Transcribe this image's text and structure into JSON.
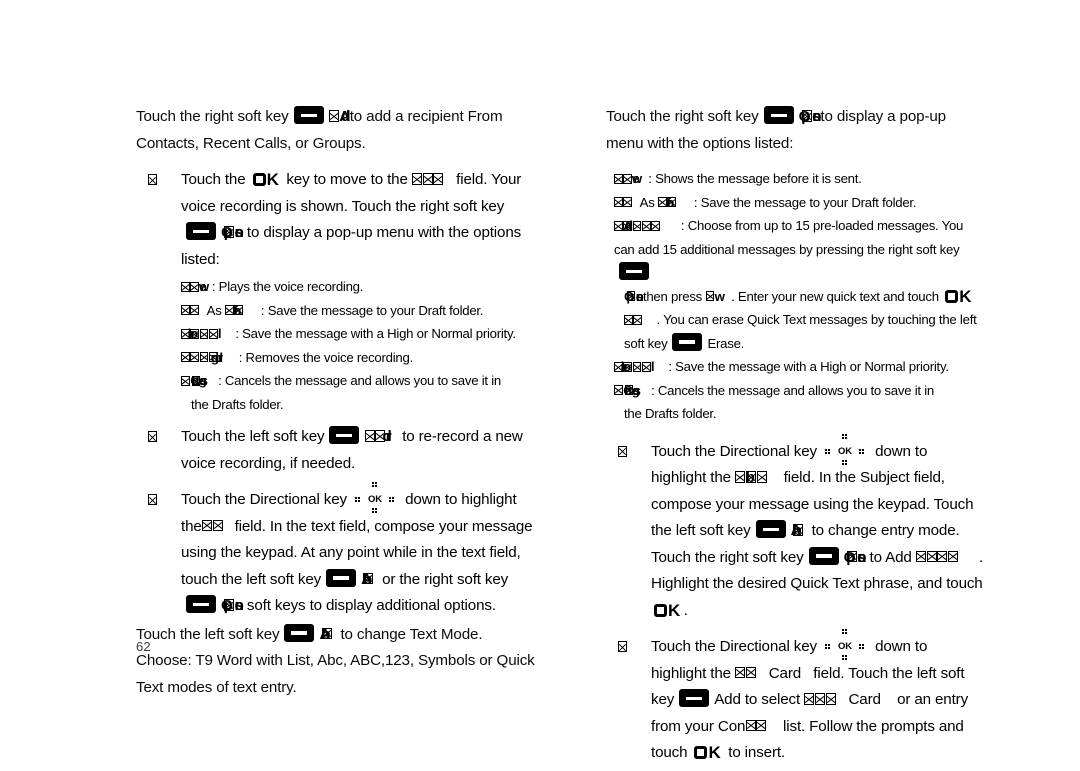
{
  "document": {
    "type": "mobile-phone-user-manual-page",
    "page_number": "62",
    "background_color": "#ffffff",
    "text_color": "#000000"
  },
  "icons": {
    "soft_key": "soft-key-icon",
    "ok_key": "ok-key-icon",
    "directional_key": "directional-key-icon",
    "bullet": "square-bullet-icon",
    "ok_key_label": "OK",
    "directional_key_label": "OK"
  },
  "left_column": {
    "intro": {
      "part1": "Touch the right soft key",
      "corrupt1": "Add",
      "part2": "to add a recipient From Contacts, Recent Calls, or Groups."
    },
    "step1": {
      "part1": "Touch the",
      "part2": "key to move to the",
      "corrupt_field": "Msg",
      "part3": "field. Your voice recording is shown. Touch the right soft key",
      "corrupt_options": "Options",
      "part4": "to display a pop-up menu with the options listed:"
    },
    "options": [
      {
        "label": "Review",
        "desc": ": Plays the voice recording."
      },
      {
        "label": "Save As Draft",
        "desc": ": Save the message to your Draft folder."
      },
      {
        "label": "Priority Level",
        "desc": ": Save the message with a High or Normal priority."
      },
      {
        "label": "Erase Recording",
        "desc": ": Removes the voice recording."
      },
      {
        "label": "Cancel Message",
        "desc": ": Cancels the message and allows you to save it in",
        "cont": "the Drafts folder."
      }
    ],
    "step2": {
      "part1": "Touch the left soft key",
      "corrupt1": "Record",
      "part2": "to re-record a new voice recording, if needed."
    },
    "step3": {
      "part1": "Touch the Directional key",
      "part2": "down to highlight the",
      "corrupt_field": "Msg",
      "part3": "field. In the text field, compose your message using the keypad. At any point while in the text field, touch the left soft key",
      "corrupt_abc": "Abc",
      "part4": "or the right soft key",
      "corrupt_options": "Options",
      "part5": "soft keys to display additional options."
    },
    "closing": {
      "part1": "Touch the left soft key",
      "corrupt_abc": "Abc",
      "part2": "to change Text Mode. Choose: T9 Word with List, Abc, ABC,123, Symbols or Quick Text modes of text entry."
    }
  },
  "right_column": {
    "intro": {
      "part1": "Touch the right soft key",
      "corrupt_options": "Options",
      "part2": "to display a pop-up menu with the options listed:"
    },
    "options": [
      {
        "label": "Review",
        "desc": ": Shows the message before it is sent."
      },
      {
        "label": "Save As Draft",
        "desc": ": Save the message to your Draft folder."
      }
    ],
    "quick_text": {
      "label": "Add Quick Text",
      "desc1": ": Choose from up to 15 pre-loaded messages. You can add 15 additional messages by pressing the right soft key",
      "corrupt_options": "Options",
      "desc2": "then press",
      "corrupt_new": "New",
      "desc3": ". Enter your new quick text and touch",
      "corrupt_save": "Save",
      "desc4": ". You can erase Quick Text messages by touching the left soft key",
      "erase_label": "Erase."
    },
    "options2": [
      {
        "label": "Priority Level",
        "desc": ": Save the message with a High or Normal priority."
      },
      {
        "label": "Cancel Message",
        "desc": ": Cancels the message and allows you to save it in",
        "cont": "the Drafts folder."
      }
    ],
    "step_subject": {
      "part1": "Touch the Directional key",
      "part2": "down to highlight the",
      "corrupt_field": "Subject",
      "part3": "field. In the Subject field, compose your message using the keypad. Touch the left soft key",
      "corrupt_abc": "Abc",
      "part4": "to change entry mode. Touch the right soft key",
      "corrupt_options": "Options",
      "part5": "to Add",
      "corrupt_quicktext": "Quick Text",
      "part6": ". Highlight the desired Quick Text phrase, and touch",
      "part7": "."
    },
    "step_bizcard": {
      "part1": "Touch the Directional key",
      "part2": "down to highlight the",
      "corrupt_field": "Biz",
      "part3": "Card",
      "part4": "field. Touch the left soft key",
      "add_label": "Add to",
      "part5": "select",
      "corrupt_my": "My Biz",
      "part6": "Card",
      "part7": "or an entry from your",
      "part8": "Con",
      "corrupt_contacts": "tacts",
      "part9": "list.",
      "part10": "Follow the prompts and touch",
      "part11": "to insert."
    }
  }
}
